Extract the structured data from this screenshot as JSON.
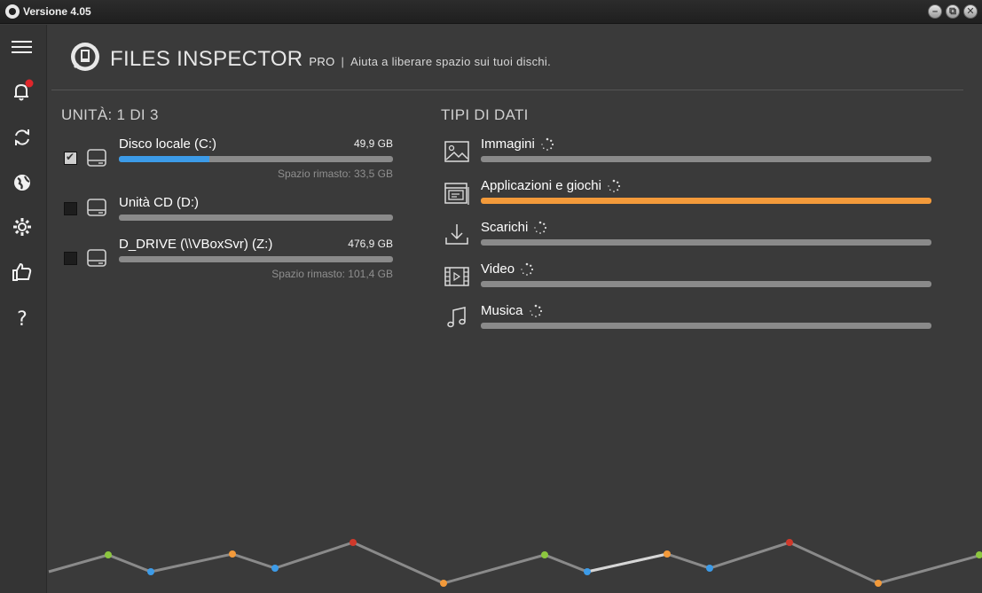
{
  "window": {
    "title": "Versione 4.05"
  },
  "header": {
    "brand": "FILES INSPECTOR",
    "edition": "PRO",
    "separator": "|",
    "tagline": "Aiuta a liberare spazio sui tuoi dischi."
  },
  "drives": {
    "section_title": "UNITÀ: 1 DI 3",
    "items": [
      {
        "name": "Disco locale (C:)",
        "size": "49,9 GB",
        "free": "Spazio rimasto: 33,5 GB",
        "checked": true,
        "used_fraction": 0.33
      },
      {
        "name": "Unità CD (D:)",
        "size": "",
        "free": "",
        "checked": false,
        "used_fraction": 0
      },
      {
        "name": "D_DRIVE (\\\\VBoxSvr) (Z:)",
        "size": "476,9 GB",
        "free": "Spazio rimasto: 101,4 GB",
        "checked": false,
        "used_fraction": 0
      }
    ]
  },
  "types": {
    "section_title": "TIPI DI DATI",
    "items": [
      {
        "label": "Immagini",
        "icon": "image-icon",
        "progress": 0
      },
      {
        "label": "Applicazioni e giochi",
        "icon": "applications-icon",
        "progress": 1.0
      },
      {
        "label": "Scarichi",
        "icon": "download-icon",
        "progress": 0
      },
      {
        "label": "Video",
        "icon": "video-icon",
        "progress": 0
      },
      {
        "label": "Musica",
        "icon": "music-icon",
        "progress": 0
      }
    ]
  },
  "sidebar": {
    "items": [
      {
        "icon": "menu-icon"
      },
      {
        "icon": "bell-icon",
        "notification": true
      },
      {
        "icon": "refresh-icon"
      },
      {
        "icon": "globe-icon"
      },
      {
        "icon": "gear-icon"
      },
      {
        "icon": "thumbs-up-icon"
      },
      {
        "icon": "help-icon"
      }
    ]
  },
  "colors": {
    "accent_blue": "#3c9be8",
    "accent_orange": "#f39a3a",
    "background": "#3a3a3a",
    "notification_red": "#e0262b"
  }
}
